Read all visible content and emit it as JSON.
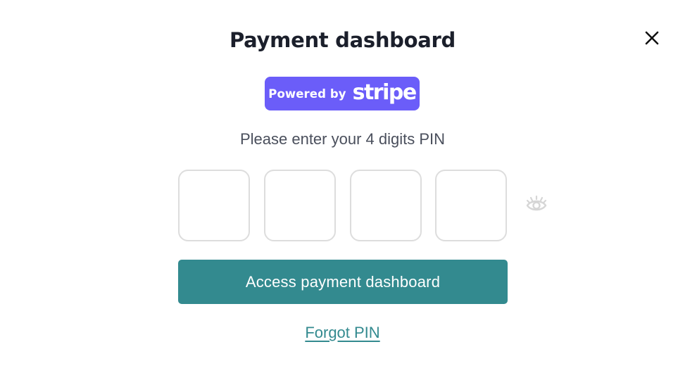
{
  "modal": {
    "title": "Payment dashboard",
    "close_icon": "close-icon"
  },
  "stripe_badge": {
    "powered_by": "Powered by",
    "brand": "stripe",
    "color": "#6b5df9"
  },
  "pin": {
    "prompt": "Please enter your 4 digits PIN",
    "digits": [
      "",
      "",
      "",
      ""
    ],
    "toggle_icon": "eye-icon"
  },
  "actions": {
    "submit_label": "Access payment dashboard",
    "forgot_label": "Forgot PIN",
    "accent_color": "#338a8f"
  }
}
